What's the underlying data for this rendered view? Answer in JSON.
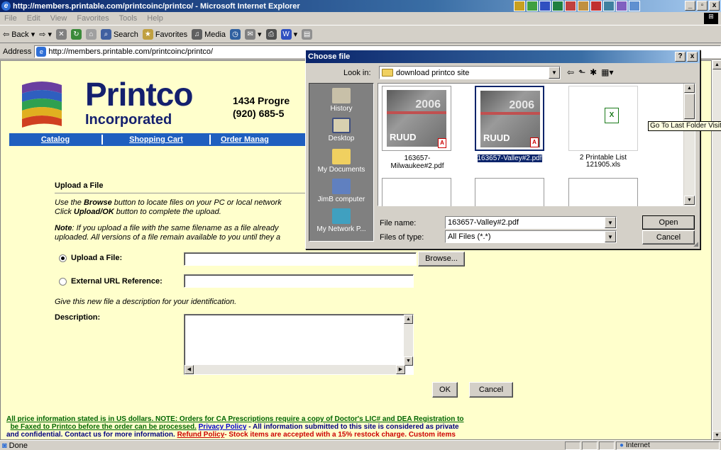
{
  "window": {
    "title": "http://members.printable.com/printcoinc/printco/ - Microsoft Internet Explorer"
  },
  "menu": [
    "File",
    "Edit",
    "View",
    "Favorites",
    "Tools",
    "Help"
  ],
  "toolbar": {
    "back": "Back",
    "search": "Search",
    "favorites": "Favorites",
    "media": "Media"
  },
  "address": {
    "label": "Address",
    "url": "http://members.printable.com/printcoinc/printco/"
  },
  "site": {
    "brand": "Printco",
    "brand_sub": "Incorporated",
    "address_line1": "1434 Progre",
    "address_line2": "(920) 685-5",
    "nav": [
      "Catalog",
      "Shopping Cart",
      "Order Manag"
    ]
  },
  "upload": {
    "heading": "Upload a File",
    "instr1_a": "Use the ",
    "instr1_b": "Browse",
    "instr1_c": " button to locate files on your PC or local network",
    "instr1_d": "Click ",
    "instr1_e": "Upload/OK",
    "instr1_f": " button to complete the upload.",
    "note_a": "Note",
    "note_b": ": If you upload a file with the same filename as a file already",
    "note_c": "uploaded. All versions of a file remain available to you until they a",
    "radio_file": "Upload a File:",
    "radio_url": "External URL Reference:",
    "browse": "Browse...",
    "give": "Give this new file a description for your identification.",
    "desc_label": "Description:",
    "ok": "OK",
    "cancel": "Cancel"
  },
  "footer": {
    "l1_green": "All price information stated is in US dollars.  NOTE: Orders for CA Prescriptions require a copy of Doctor's LIC# and DEA Registration to",
    "l2_green": "be Faxed to Printco before the order can be processed.",
    "l2_privacy": "Privacy Policy",
    "l2_blue": " - All information submitted to this site is considered as private",
    "l3_blue": "and confidential. Contact us for more information.  ",
    "l3_refund": "Refund Policy",
    "l3_red": "- Stock items are accepted with a 15% restock charge. Custom items"
  },
  "dialog": {
    "title": "Choose file",
    "look_in_label": "Look in:",
    "look_in": "download printco site",
    "places": [
      "History",
      "Desktop",
      "My Documents",
      "JimB computer",
      "My Network P..."
    ],
    "files": [
      {
        "name": "163657-Milwaukee#2.pdf",
        "year": "2006",
        "brand": "RUUD"
      },
      {
        "name": "163657-Valley#2.pdf",
        "year": "2006",
        "brand": "RUUD"
      },
      {
        "name": "2 Printable List 121905.xls"
      }
    ],
    "tooltip": "Go To Last Folder Visited",
    "file_name_label": "File name:",
    "file_name": "163657-Valley#2.pdf",
    "file_type_label": "Files of type:",
    "file_type": "All Files (*.*)",
    "open": "Open",
    "cancel": "Cancel",
    "help": "?",
    "close": "x"
  },
  "status": {
    "left": "Done",
    "zone": "Internet"
  }
}
